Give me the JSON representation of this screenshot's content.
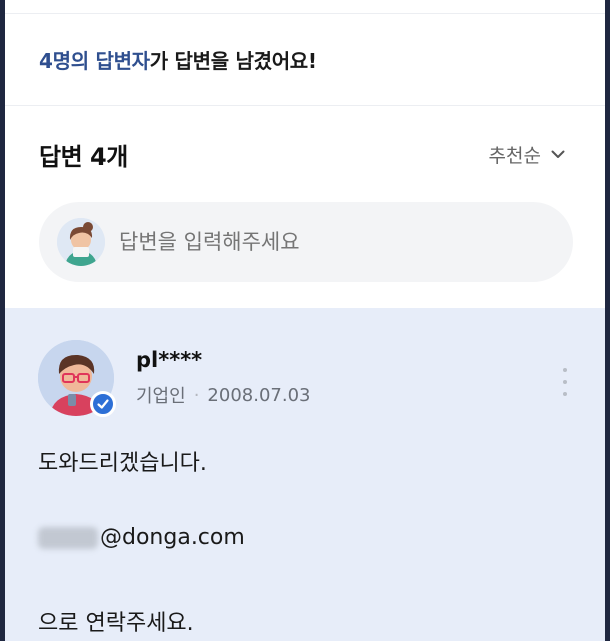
{
  "summary": {
    "count_text": "4명의 답변자",
    "suffix_text": "가 답변을 남겼어요!"
  },
  "answers_header": {
    "title": "답변 4개",
    "sort_label": "추천순"
  },
  "answer_input": {
    "placeholder": "답변을 입력해주세요"
  },
  "answer": {
    "author": "pl****",
    "role": "기업인",
    "separator": "·",
    "date": "2008.07.03",
    "lines": [
      "도와드리겠습니다.",
      "@donga.com",
      "으로 연락주세요."
    ]
  },
  "icons": {
    "sort": "chevron-down-icon",
    "badge": "verified-badge-icon",
    "more": "more-vertical-icon"
  },
  "colors": {
    "highlight": "#2f4f8f",
    "answer_bg": "#e7edf9",
    "badge": "#2d6fd6"
  }
}
